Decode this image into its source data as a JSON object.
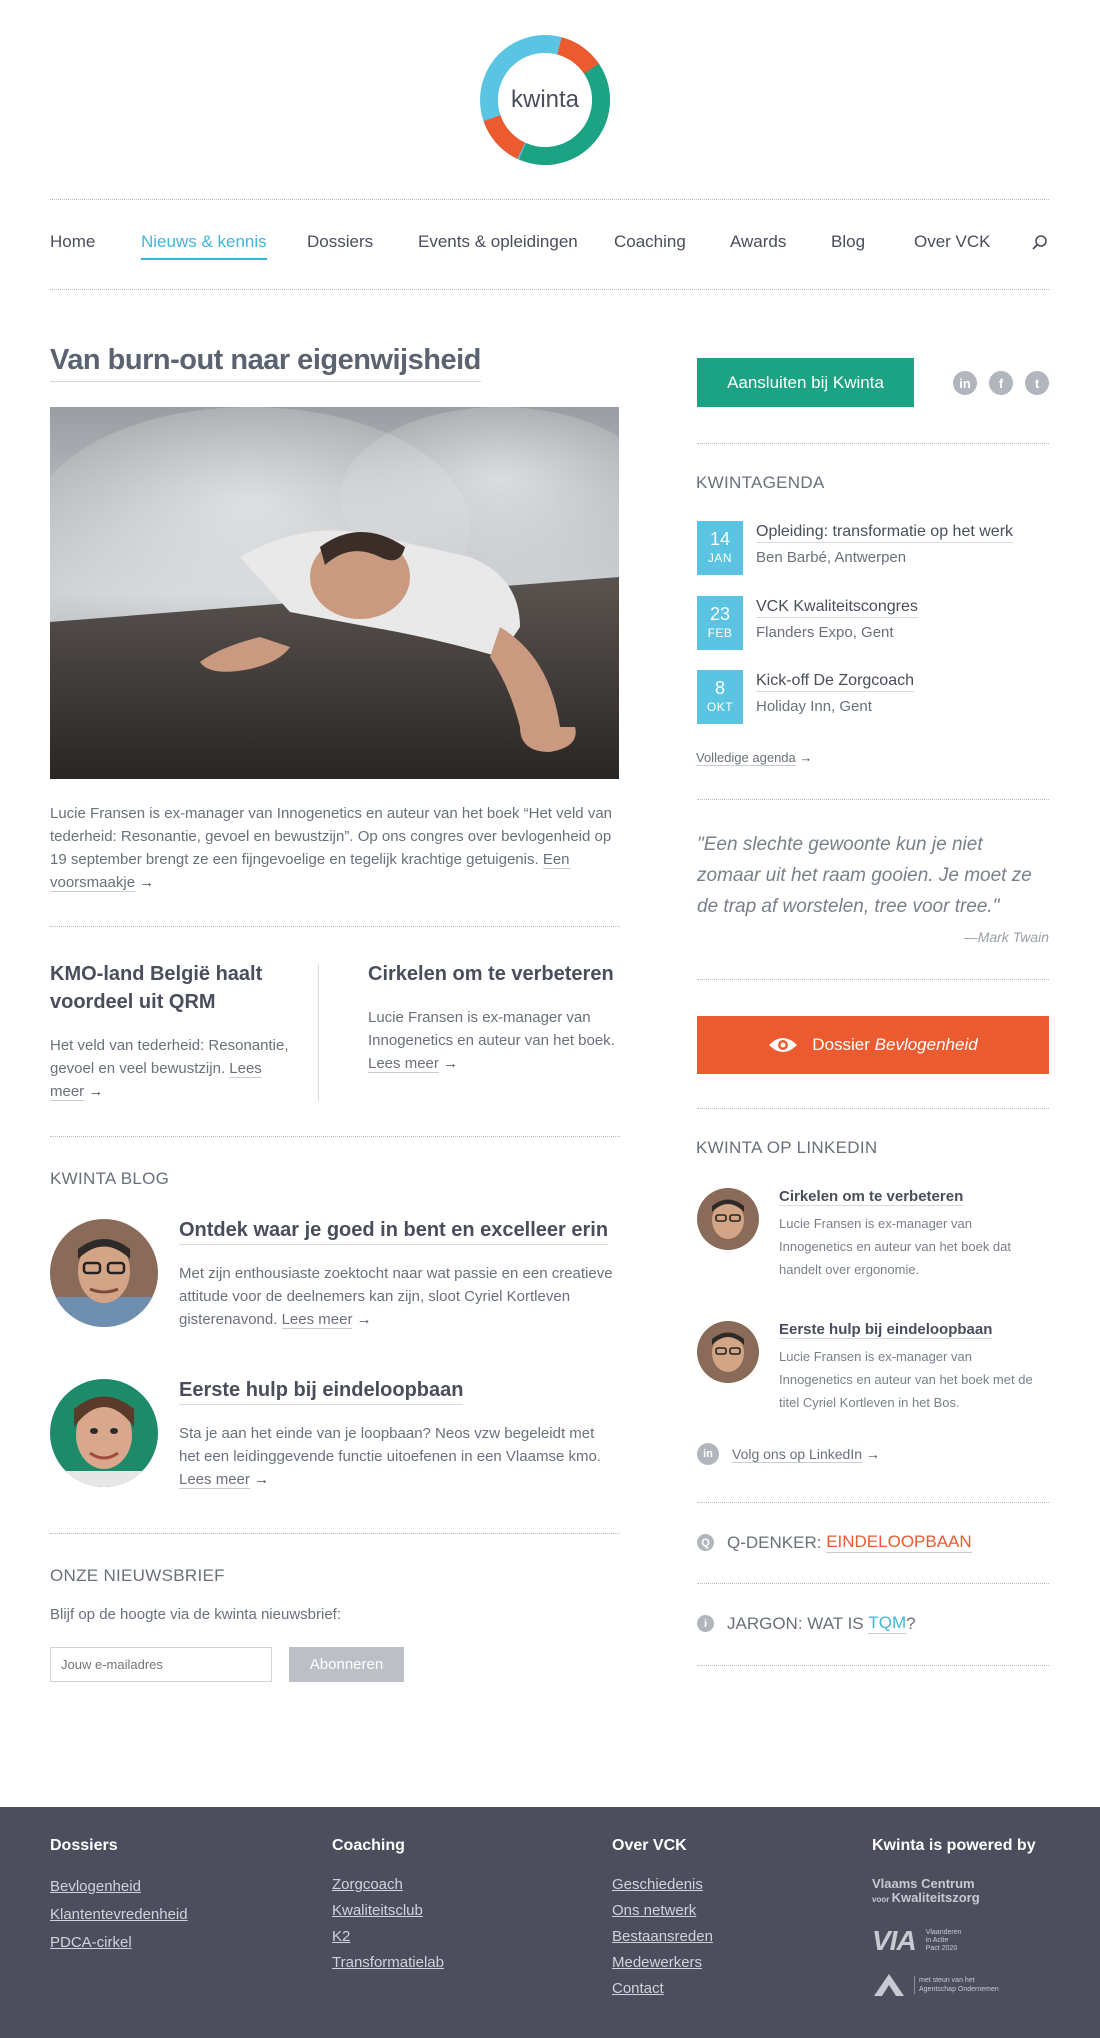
{
  "brand": {
    "logo_text": "kwinta",
    "colors": {
      "teal": "#1ba383",
      "blue": "#5ac4e2",
      "orange": "#ec5a2f",
      "footer": "#4c4e5e"
    }
  },
  "nav": {
    "items": [
      {
        "label": "Home",
        "active": false
      },
      {
        "label": "Nieuws & kennis",
        "active": true
      },
      {
        "label": "Dossiers",
        "active": false
      },
      {
        "label": "Events & opleidingen",
        "active": false
      },
      {
        "label": "Coaching",
        "active": false
      },
      {
        "label": "Awards",
        "active": false
      },
      {
        "label": "Blog",
        "active": false
      },
      {
        "label": "Over VCK",
        "active": false
      }
    ],
    "search_icon": "search-icon"
  },
  "article": {
    "title": "Van burn-out naar eigenwijsheid",
    "intro": "Lucie Fransen is ex-manager van Innogenetics en auteur van het boek “Het veld van tederheid: Resonantie, gevoel en bewustzijn”. Op ons congres over bevlogenheid op 19 september brengt ze een fijngevoelige en tegelijk krachtige getuigenis.",
    "intro_link": "Een voorsmaakje",
    "arrow": "→"
  },
  "teasers": [
    {
      "title": "KMO-land België haalt voordeel uit QRM",
      "text": "Het veld van tederheid: Resonantie, gevoel en veel bewustzijn.",
      "link": "Lees meer"
    },
    {
      "title": "Cirkelen om te verbeteren",
      "text": "Lucie Fransen is ex-manager van Innogenetics en auteur van het boek.",
      "link": "Lees meer"
    }
  ],
  "blog": {
    "section_title": "KWINTA BLOG",
    "posts": [
      {
        "title": "Ontdek waar je goed in bent en excelleer erin",
        "text": "Met zijn enthousiaste zoektocht naar wat passie en een creatieve attitude voor de deelnemers kan zijn, sloot Cyriel Kortleven gisterenavond.",
        "link": "Lees meer"
      },
      {
        "title": "Eerste hulp bij eindeloopbaan",
        "text": "Sta je aan het einde van je loopbaan? Neos vzw begeleidt met het een leidinggevende functie uitoefenen in een Vlaamse kmo.",
        "link": "Lees meer"
      }
    ]
  },
  "newsletter": {
    "title": "ONZE NIEUWSBRIEF",
    "text": "Blijf op de hoogte via de kwinta nieuwsbrief:",
    "placeholder": "Jouw e-mailadres",
    "button": "Abonneren"
  },
  "sidebar": {
    "join_button": "Aansluiten bij Kwinta",
    "social": [
      "linkedin-icon",
      "facebook-icon",
      "twitter-icon"
    ],
    "social_glyphs": [
      "in",
      "f",
      "t"
    ],
    "agenda_title": "KWINTAGENDA",
    "events": [
      {
        "day": "14",
        "month": "JAN",
        "title": "Opleiding: transformatie op het werk",
        "sub": "Ben Barbé, Antwerpen"
      },
      {
        "day": "23",
        "month": "FEB",
        "title": "VCK Kwaliteitscongres",
        "sub": "Flanders Expo, Gent"
      },
      {
        "day": "8",
        "month": "OKT",
        "title": "Kick-off De Zorgcoach",
        "sub": "Holiday Inn, Gent"
      }
    ],
    "agenda_link": "Volledige agenda",
    "quote": "\"Een slechte gewoonte kun je niet zomaar uit het raam gooien. Je moet ze de trap af worstelen, tree voor tree.\"",
    "quote_author": "—Mark Twain",
    "dossier_prefix": "Dossier ",
    "dossier_name": "Bevlogenheid",
    "linkedin_title": "KWINTA OP LINKEDIN",
    "linkedin_posts": [
      {
        "title": "Cirkelen om te verbeteren",
        "text": "Lucie Fransen is ex-manager van Innogenetics en auteur van het boek dat handelt over ergonomie."
      },
      {
        "title": "Eerste hulp bij eindeloopbaan",
        "text": "Lucie Fransen is ex-manager van Innogenetics en auteur van het boek met de titel Cyriel Kortleven in het Bos."
      }
    ],
    "linkedin_follow": "Volg ons op LinkedIn",
    "qdenker_label": "Q-DENKER: ",
    "qdenker_value": "EINDELOOPBAAN",
    "jargon_label": "JARGON: WAT IS ",
    "jargon_value": "TQM",
    "jargon_q": "?"
  },
  "footer": {
    "columns": [
      {
        "title": "Dossiers",
        "links": [
          "Bevlogenheid",
          "Klantentevredenheid",
          "PDCA-cirkel"
        ]
      },
      {
        "title": "Coaching",
        "links": [
          "Zorgcoach",
          "Kwaliteitsclub",
          "K2",
          "Transformatielab"
        ]
      },
      {
        "title": "Over VCK",
        "links": [
          "Geschiedenis",
          "Ons netwerk",
          "Bestaansreden",
          "Medewerkers",
          "Contact"
        ]
      }
    ],
    "powered_title": "Kwinta is powered by",
    "vck_line1": "Vlaams Centrum",
    "vck_line2a": "voor ",
    "vck_line2b": "Kwaliteitszorg",
    "via_logo": "VIA",
    "via_sub": [
      "Vlaanderen",
      "in Actie",
      "Pact 2020"
    ],
    "agent_sub": [
      "met steun van het",
      "Agentschap Ondernemen"
    ]
  }
}
